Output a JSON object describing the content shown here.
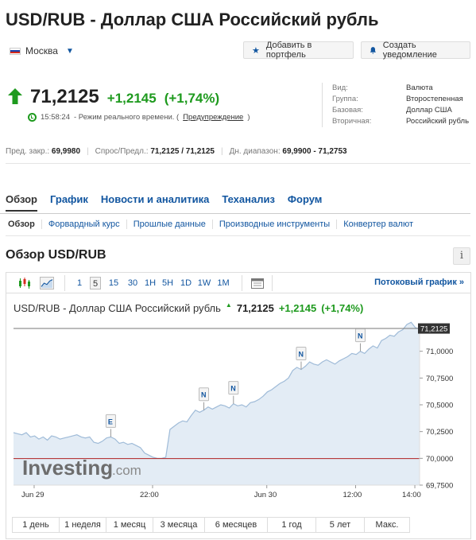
{
  "header": {
    "title": "USD/RUB - Доллар США Российский рубль",
    "location": "Москва",
    "add_portfolio": "Добавить в портфель",
    "create_alert": "Создать уведомление"
  },
  "quote": {
    "price": "71,2125",
    "change": "+1,2145",
    "change_pct": "(+1,74%)",
    "time": "15:58:24",
    "realtime_text": "- Режим реального времени. (",
    "warning_link": "Предупреждение",
    "close_paren": ")"
  },
  "info": {
    "rows": [
      {
        "k": "Вид:",
        "v": "Валюта"
      },
      {
        "k": "Группа:",
        "v": "Второстепенная"
      },
      {
        "k": "Базовая:",
        "v": "Доллар США"
      },
      {
        "k": "Вторичная:",
        "v": "Российский рубль"
      }
    ]
  },
  "stats": {
    "prev_label": "Пред. закр.:",
    "prev_value": "69,9980",
    "bidask_label": "Спрос/Предл.:",
    "bidask_value": "71,2125 / 71,2125",
    "range_label": "Дн. диапазон:",
    "range_value": "69,9900 - 71,2753"
  },
  "tabs": [
    "Обзор",
    "График",
    "Новости и аналитика",
    "Теханализ",
    "Форум"
  ],
  "subtabs": [
    "Обзор",
    "Форвардный курс",
    "Прошлые данные",
    "Производные инструменты",
    "Конвертер валют"
  ],
  "section_title": "Обзор USD/RUB",
  "info_icon": "i",
  "toolbar": {
    "intervals": [
      "1",
      "5",
      "15",
      "30",
      "1H",
      "5H",
      "1D",
      "1W",
      "1M"
    ],
    "selected": "5",
    "stream_link": "Потоковый график »"
  },
  "chart_header": {
    "name": "USD/RUB - Доллар США Российский рубль",
    "price": "71,2125",
    "change": "+1,2145",
    "change_pct": "(+1,74%)"
  },
  "chart_data": {
    "type": "area",
    "x_ticks": [
      "Jun 29",
      "22:00",
      "Jun 30",
      "12:00",
      "14:00"
    ],
    "y_ticks": [
      "71,0000",
      "70,7500",
      "70,5000",
      "70,2500",
      "70,0000",
      "69,7500"
    ],
    "ylim": [
      69.75,
      71.25
    ],
    "last_value_label": "71,2125",
    "last_value": 71.2125,
    "prev_close": 69.998,
    "watermark": "Investing",
    "watermark_suffix": ".com",
    "series": [
      {
        "values": [
          70.24,
          70.23,
          70.22,
          70.24,
          70.2,
          70.21,
          70.18,
          70.2,
          70.17,
          70.21,
          70.2,
          70.18,
          70.19,
          70.2,
          70.21,
          70.22,
          70.2,
          70.19,
          70.2,
          70.15,
          70.14,
          70.16,
          70.19,
          70.2,
          70.18,
          70.14,
          70.15,
          70.13,
          70.14,
          70.12,
          70.1,
          70.05,
          70.03,
          70.01,
          70.0,
          70.0,
          70.01,
          70.27,
          70.3,
          70.33,
          70.35,
          70.34,
          70.4,
          70.45,
          70.43,
          70.45,
          70.48,
          70.46,
          70.48,
          70.5,
          70.49,
          70.47,
          70.51,
          70.49,
          70.5,
          70.48,
          70.52,
          70.53,
          70.55,
          70.58,
          70.62,
          70.64,
          70.67,
          70.7,
          70.72,
          70.75,
          70.82,
          70.85,
          70.83,
          70.86,
          70.9,
          70.88,
          70.87,
          70.9,
          70.92,
          70.9,
          70.88,
          70.91,
          70.93,
          70.95,
          70.98,
          70.97,
          71.0,
          70.98,
          71.02,
          71.05,
          71.03,
          71.1,
          71.12,
          71.15,
          71.14,
          71.18,
          71.2,
          71.25,
          71.27,
          71.22,
          71.21
        ]
      }
    ],
    "event_markers": [
      {
        "label": "E",
        "index": 23
      },
      {
        "label": "N",
        "index": 45
      },
      {
        "label": "N",
        "index": 52
      },
      {
        "label": "N",
        "index": 68
      },
      {
        "label": "N",
        "index": 82
      }
    ]
  },
  "ranges": [
    "1 день",
    "1 неделя",
    "1 месяц",
    "3 месяца",
    "6 месяцев",
    "1 год",
    "5 лет",
    "Макс."
  ],
  "colors": {
    "positive": "#1e9a1e",
    "link": "#1256a0",
    "area_fill": "#e3ecf5",
    "line": "#9fbbd8",
    "prev_close_line": "#b02020"
  },
  "icons": {
    "portfolio": "star-icon",
    "alert": "bell-icon",
    "location_flag": "russia-flag-icon"
  }
}
